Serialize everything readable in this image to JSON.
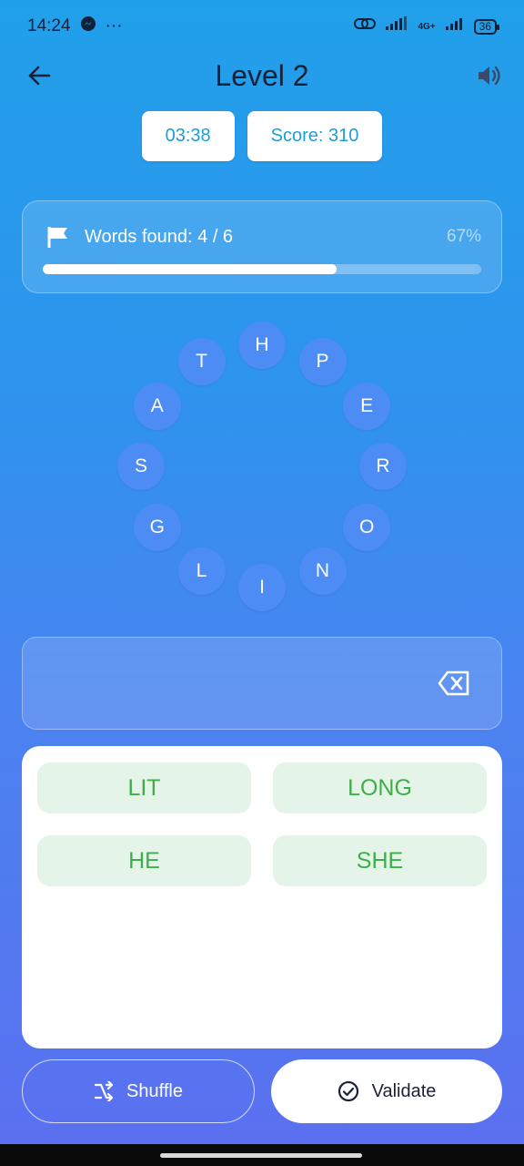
{
  "status_bar": {
    "time": "14:24",
    "messenger_icon": "messenger-icon",
    "more": "···",
    "network_label": "4G+",
    "battery": "36"
  },
  "app_bar": {
    "title": "Level 2",
    "back_icon": "arrow-left-icon",
    "sound_icon": "speaker-icon"
  },
  "chips": {
    "timer": "03:38",
    "score": "Score: 310"
  },
  "progress": {
    "label": "Words found: 4 / 6",
    "percent_text": "67%",
    "fraction": 0.67,
    "icon": "flag-icon"
  },
  "letters": [
    "H",
    "P",
    "E",
    "R",
    "O",
    "N",
    "I",
    "L",
    "G",
    "S",
    "A",
    "T"
  ],
  "found_words": [
    "LIT",
    "LONG",
    "HE",
    "SHE"
  ],
  "buttons": {
    "shuffle": "Shuffle",
    "validate": "Validate"
  },
  "colors": {
    "accent": "#1c9fd6",
    "letter_bg": "#4d8cf5",
    "word_green": "#3fae4a",
    "word_bg": "#e5f4e8"
  }
}
